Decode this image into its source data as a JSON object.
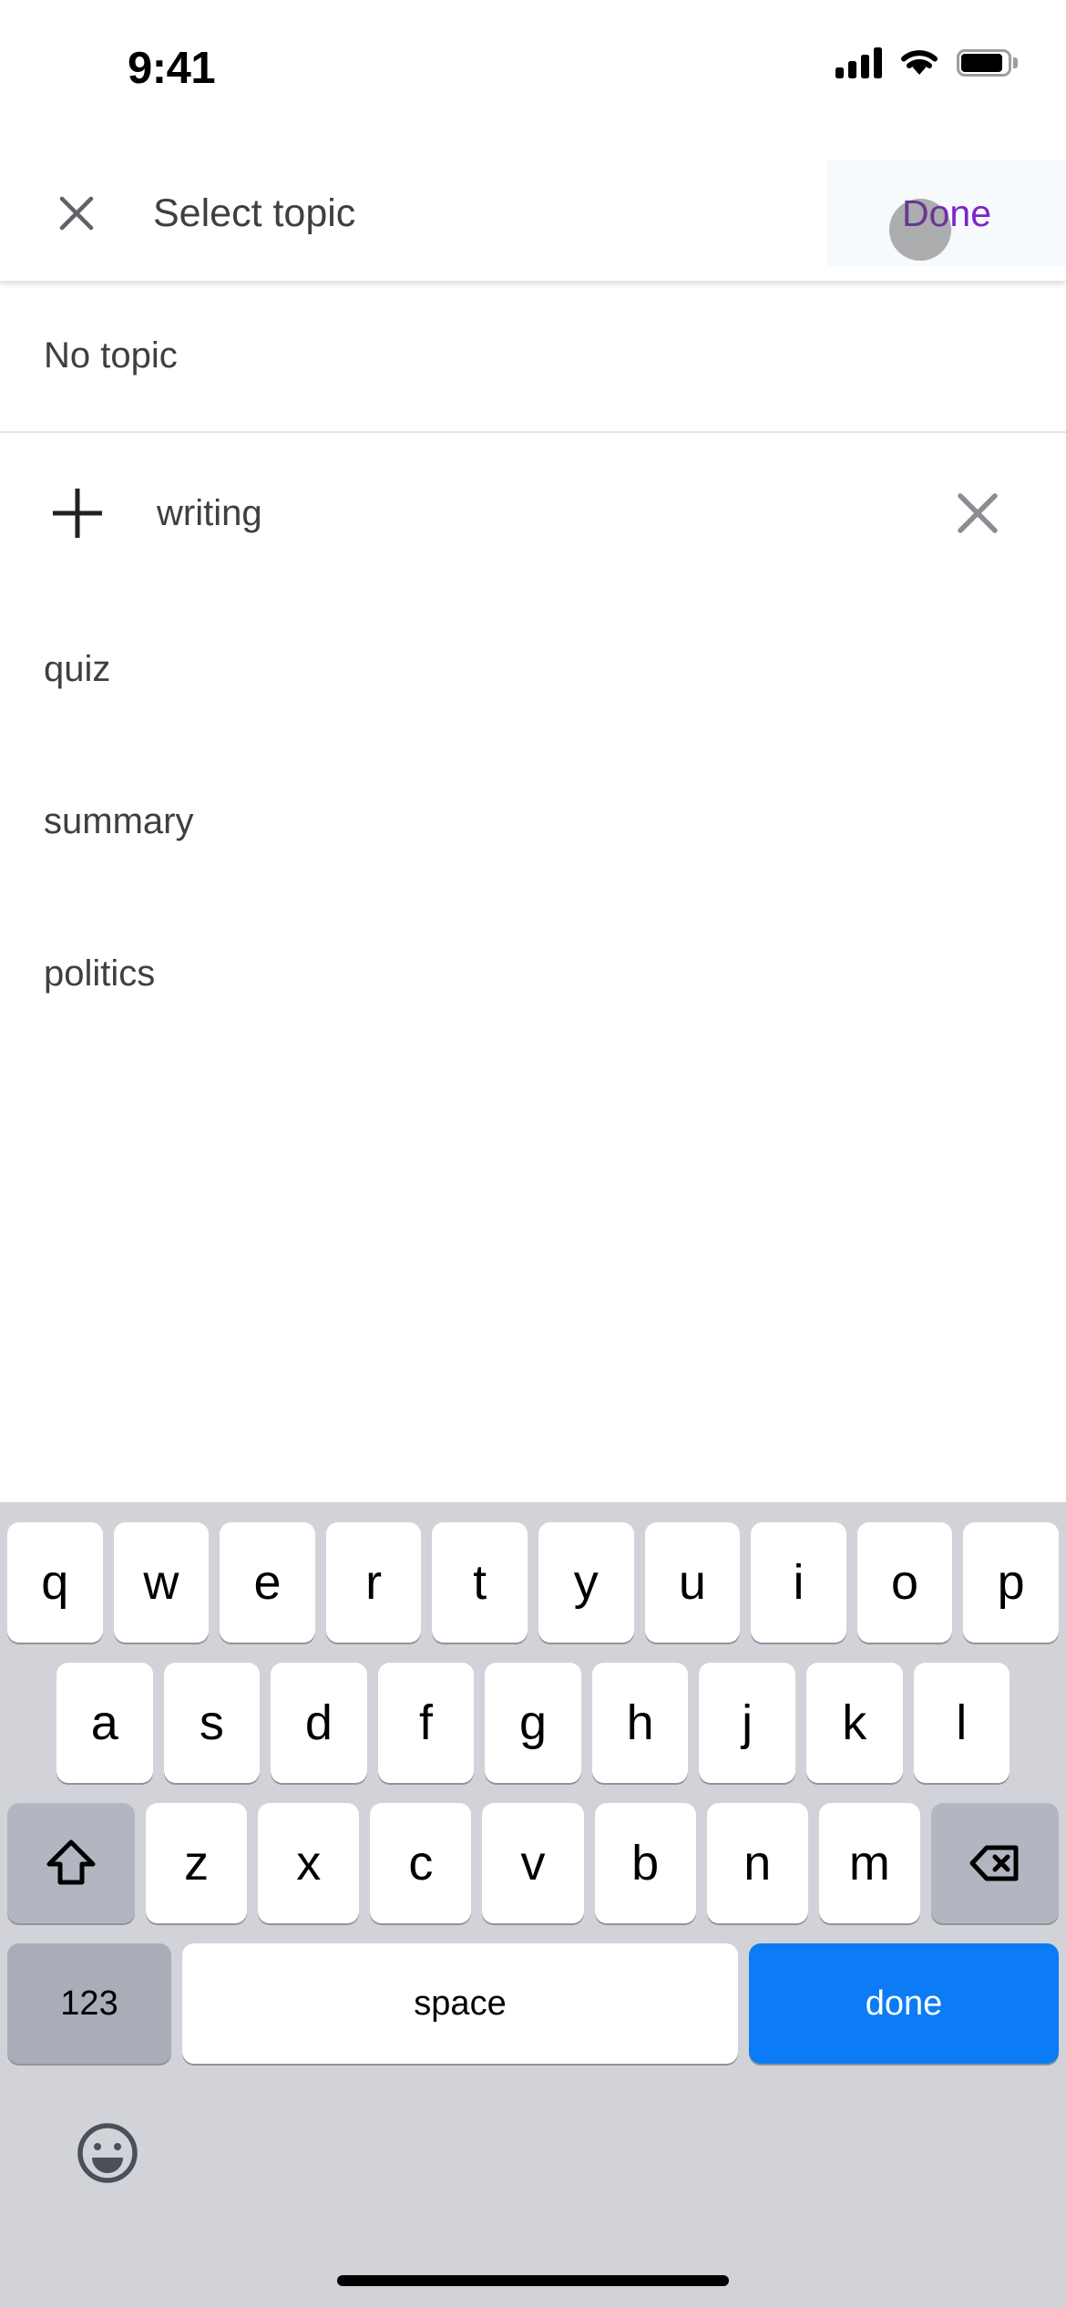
{
  "status_bar": {
    "time": "9:41",
    "cellular_icon": "cellular-signal-icon",
    "wifi_icon": "wifi-icon",
    "battery_icon": "battery-full-icon"
  },
  "header": {
    "close_icon": "close-icon",
    "title": "Select topic",
    "done_label": "Done",
    "done_text_color": "#7c24c8",
    "done_bg_color": "#f6fafd",
    "touch_indicator": "touch-point-indicator"
  },
  "list": {
    "no_topic_label": "No topic",
    "create_row": {
      "add_icon": "plus-icon",
      "value": "writing",
      "clear_icon": "clear-icon"
    },
    "topics": [
      {
        "label": "quiz"
      },
      {
        "label": "summary"
      },
      {
        "label": "politics"
      }
    ]
  },
  "keyboard": {
    "row1": [
      "q",
      "w",
      "e",
      "r",
      "t",
      "y",
      "u",
      "i",
      "o",
      "p"
    ],
    "row2": [
      "a",
      "s",
      "d",
      "f",
      "g",
      "h",
      "j",
      "k",
      "l"
    ],
    "row3": [
      "z",
      "x",
      "c",
      "v",
      "b",
      "n",
      "m"
    ],
    "shift_icon": "shift-icon",
    "backspace_icon": "backspace-icon",
    "numeric_label": "123",
    "space_label": "space",
    "return_label": "done",
    "return_bg_color": "#0b7cf5",
    "emoji_icon": "emoji-icon",
    "background_color": "#d1d3d9"
  },
  "home_indicator": "home-indicator"
}
